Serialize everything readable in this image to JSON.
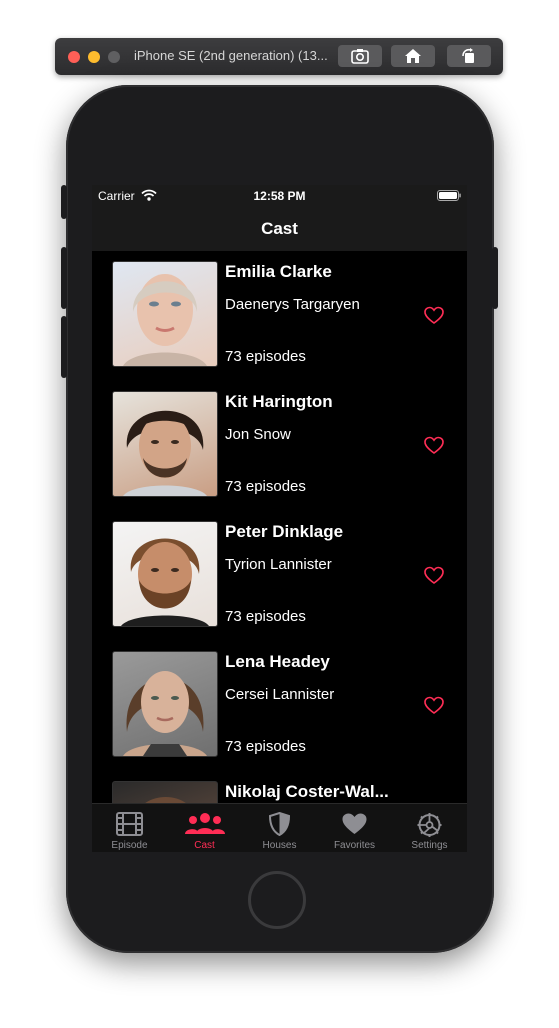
{
  "simulator": {
    "title": "iPhone SE (2nd generation) (13...",
    "traffic_colors": [
      "#ff5f57",
      "#febc2e",
      "#5f5f61"
    ]
  },
  "status_bar": {
    "carrier": "Carrier",
    "time": "12:58 PM"
  },
  "nav": {
    "title": "Cast"
  },
  "cast": [
    {
      "name": "Emilia Clarke",
      "role": "Daenerys Targaryen",
      "episodes": "73 episodes",
      "photo_bg": [
        "#dfe7f2",
        "#e9cdbd"
      ]
    },
    {
      "name": "Kit Harington",
      "role": "Jon Snow",
      "episodes": "73 episodes",
      "photo_bg": [
        "#e6e3dc",
        "#c99e84"
      ]
    },
    {
      "name": "Peter Dinklage",
      "role": "Tyrion Lannister",
      "episodes": "73 episodes",
      "photo_bg": [
        "#f4f4f4",
        "#b9835c"
      ]
    },
    {
      "name": "Lena Headey",
      "role": "Cersei Lannister",
      "episodes": "73 episodes",
      "photo_bg": [
        "#8d8d8d",
        "#d8b29a"
      ]
    },
    {
      "name": "Nikolaj Coster-Wal...",
      "role": "",
      "episodes": "",
      "photo_bg": [
        "#2a2a2a",
        "#7a5a48"
      ]
    }
  ],
  "tabs": [
    {
      "label": "Episode",
      "icon": "film-icon",
      "active": false
    },
    {
      "label": "Cast",
      "icon": "people-icon",
      "active": true
    },
    {
      "label": "Houses",
      "icon": "shield-icon",
      "active": false
    },
    {
      "label": "Favorites",
      "icon": "heart-icon",
      "active": false
    },
    {
      "label": "Settings",
      "icon": "gear-icon",
      "active": false
    }
  ],
  "colors": {
    "accent": "#ff2d55",
    "tab_inactive": "#8e8e93",
    "background": "#000000"
  }
}
